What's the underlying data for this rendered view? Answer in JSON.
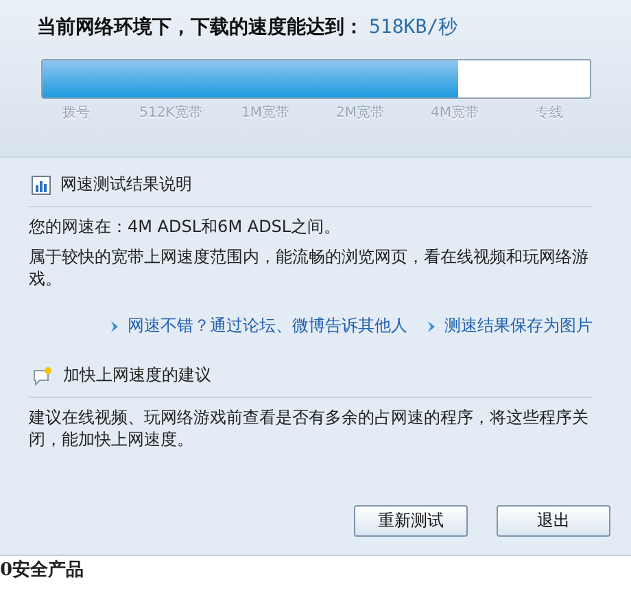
{
  "headline": {
    "label": "当前网络环境下，下载的速度能达到：",
    "speed": "518KB/秒"
  },
  "meter": {
    "level": 0.76,
    "scale": [
      "拨号",
      "512K宽带",
      "1M宽带",
      "2M宽带",
      "4M宽带",
      "专线"
    ]
  },
  "result": {
    "title": "网速测试结果说明",
    "paragraphs": [
      "您的网速在：4M ADSL和6M ADSL之间。",
      "属于较快的宽带上网速度范围内，能流畅的浏览网页，看在线视频和玩网络游戏。"
    ],
    "links": [
      "网速不错？通过论坛、微博告诉其他人",
      "测速结果保存为图片"
    ]
  },
  "advice": {
    "title": "加快上网速度的建议",
    "paragraphs": [
      "建议在线视频、玩网络游戏前查看是否有多余的占网速的程序，将这些程序关闭，能加快上网速度。"
    ]
  },
  "buttons": [
    "重新测试",
    "退出"
  ],
  "caption": "0安全产品"
}
